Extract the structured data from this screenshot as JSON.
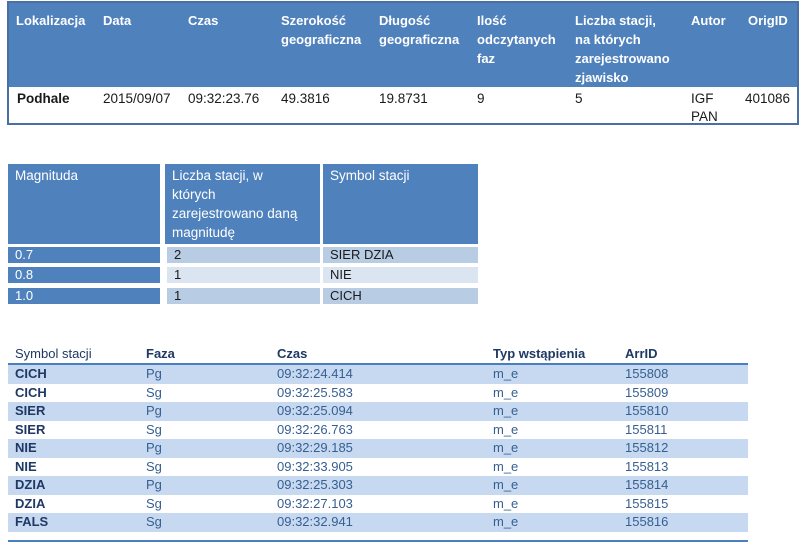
{
  "event_table": {
    "headers": {
      "lokalizacja": "Lokalizacja",
      "data": "Data",
      "czas": "Czas",
      "szer_1": "Szerokość",
      "szer_2": "geograficzna",
      "dlug_1": "Długość",
      "dlug_2": "geograficzna",
      "ilosc_1": "Ilość",
      "ilosc_2": "odczytanych",
      "ilosc_3": "faz",
      "liczba_1": "Liczba stacji,",
      "liczba_2": "na których",
      "liczba_3": "zarejestrowano",
      "liczba_4": "zjawisko",
      "autor": "Autor",
      "origid": "OrigID"
    },
    "row": {
      "lokalizacja": "Podhale",
      "data": "2015/09/07",
      "czas": "09:32:23.76",
      "szerokosc": "49.3816",
      "dlugosc": "19.8731",
      "ilosc_faz": "9",
      "liczba_stacji": "5",
      "autor_1": "IGF",
      "autor_2": "PAN",
      "origid": "401086"
    }
  },
  "magnitude_table": {
    "headers": {
      "magnituda": "Magnituda",
      "liczba_1": "Liczba stacji, w",
      "liczba_2": "których",
      "liczba_3": "zarejestrowano daną",
      "liczba_4": "magnitudę",
      "symbol": "Symbol stacji"
    },
    "rows": [
      {
        "magnituda": "0.7",
        "liczba": "2",
        "symbol": "SIER DZIA"
      },
      {
        "magnituda": "0.8",
        "liczba": "1",
        "symbol": "NIE"
      },
      {
        "magnituda": "1.0",
        "liczba": "1",
        "symbol": "CICH"
      }
    ]
  },
  "phase_table": {
    "headers": {
      "symbol": "Symbol stacji",
      "faza": "Faza",
      "czas": "Czas",
      "typ": "Typ wstąpienia",
      "arrid": "ArrID"
    },
    "rows": [
      {
        "symbol": "CICH",
        "faza": "Pg",
        "czas": "09:32:24.414",
        "typ": "m_e",
        "arrid": "155808"
      },
      {
        "symbol": "CICH",
        "faza": "Sg",
        "czas": "09:32:25.583",
        "typ": "m_e",
        "arrid": "155809"
      },
      {
        "symbol": "SIER",
        "faza": "Pg",
        "czas": "09:32:25.094",
        "typ": "m_e",
        "arrid": "155810"
      },
      {
        "symbol": "SIER",
        "faza": "Sg",
        "czas": "09:32:26.763",
        "typ": "m_e",
        "arrid": "155811"
      },
      {
        "symbol": "NIE",
        "faza": "Pg",
        "czas": "09:32:29.185",
        "typ": "m_e",
        "arrid": "155812"
      },
      {
        "symbol": "NIE",
        "faza": "Sg",
        "czas": "09:32:33.905",
        "typ": "m_e",
        "arrid": "155813"
      },
      {
        "symbol": "DZIA",
        "faza": "Pg",
        "czas": "09:32:25.303",
        "typ": "m_e",
        "arrid": "155814"
      },
      {
        "symbol": "DZIA",
        "faza": "Sg",
        "czas": "09:32:27.103",
        "typ": "m_e",
        "arrid": "155815"
      },
      {
        "symbol": "FALS",
        "faza": "Sg",
        "czas": "09:32:32.941",
        "typ": "m_e",
        "arrid": "155816"
      }
    ]
  },
  "colors": {
    "header_blue": "#4f81bd",
    "band_light": "#c6d9f1",
    "text_dark_blue": "#1f3864"
  }
}
